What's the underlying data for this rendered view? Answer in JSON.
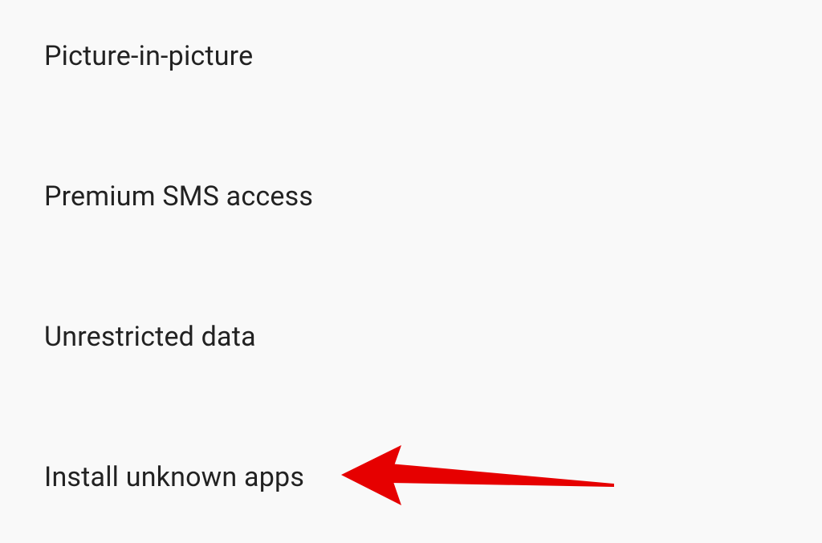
{
  "settings": {
    "items": [
      {
        "label": "Picture-in-picture"
      },
      {
        "label": "Premium SMS access"
      },
      {
        "label": "Unrestricted data"
      },
      {
        "label": "Install unknown apps"
      }
    ]
  },
  "annotation": {
    "arrow_color": "#e60000"
  }
}
